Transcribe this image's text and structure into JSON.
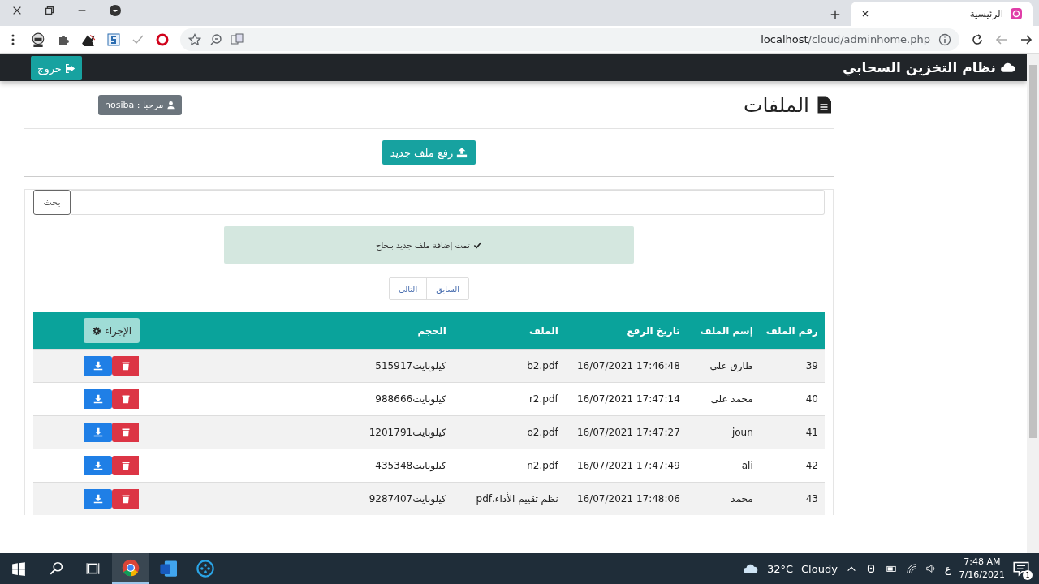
{
  "browser": {
    "tab_title": "الرئيسية",
    "url_host": "localhost",
    "url_path": "/cloud/adminhome.php"
  },
  "navbar": {
    "brand": "نظام التخزين السحابي",
    "logout": "خروج"
  },
  "page": {
    "title": "الملفات",
    "welcome": "مرحبا : nosiba",
    "upload": "رفع ملف جديد",
    "search_button": "بحث",
    "alert": "تمت إضافة ملف جديد بنجاح",
    "pagination": [
      "السابق",
      "التالي"
    ]
  },
  "table": {
    "columns": [
      "رقم الملف",
      "إسم الملف",
      "تاريخ الرفع",
      "الملف",
      "الحجم"
    ],
    "action_header": "الإجراء",
    "rows": [
      {
        "cells": [
          "39",
          "طارق على",
          "16/07/2021 17:46:48",
          "b2.pdf",
          "515917كيلوبايت"
        ]
      },
      {
        "cells": [
          "40",
          "محمد على",
          "16/07/2021 17:47:14",
          "r2.pdf",
          "988666كيلوبايت"
        ]
      },
      {
        "cells": [
          "41",
          "joun",
          "16/07/2021 17:47:27",
          "o2.pdf",
          "1201791كيلوبايت"
        ]
      },
      {
        "cells": [
          "42",
          "ali",
          "16/07/2021 17:47:49",
          "n2.pdf",
          "435348كيلوبايت"
        ]
      },
      {
        "cells": [
          "43",
          "محمد",
          "16/07/2021 17:48:06",
          "نظم تقييم الأداء.pdf",
          "9287407كيلوبايت"
        ]
      }
    ]
  },
  "taskbar": {
    "temperature": "32°C",
    "condition": "Cloudy",
    "language": "ع",
    "time": "7:48 AM",
    "date": "7/16/2021",
    "notifications": "1"
  }
}
